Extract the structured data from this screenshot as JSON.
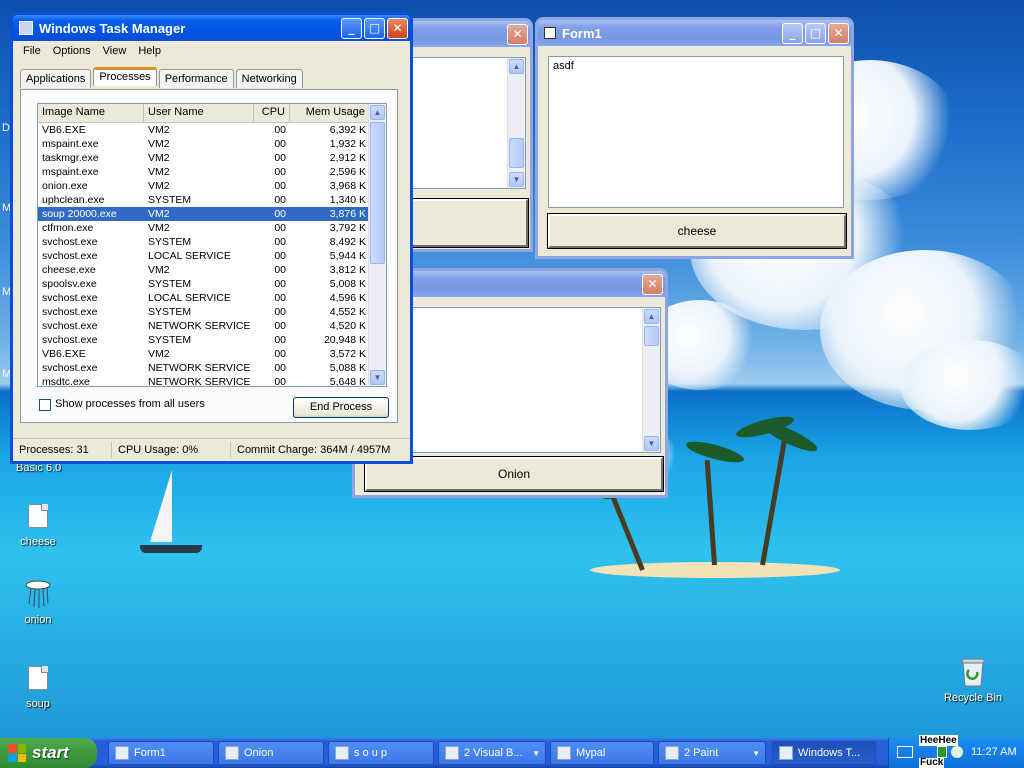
{
  "colors": {
    "xp_blue": "#0054e3",
    "selection": "#316ac5",
    "start_green": "#3c9a3c",
    "tray_blue": "#0f6fd8"
  },
  "desktop": {
    "partial_label": "Basic 6.0",
    "left_edge_letters": [
      "D",
      "M",
      "M",
      "M"
    ],
    "icons": [
      {
        "label": "cheese",
        "icon": "folder-icon"
      },
      {
        "label": "onion",
        "icon": "onion-icon"
      },
      {
        "label": "soup",
        "icon": "file-icon"
      },
      {
        "label": "Recycle Bin",
        "icon": "recycle-bin-icon"
      }
    ]
  },
  "task_manager": {
    "title": "Windows Task Manager",
    "menu": [
      "File",
      "Options",
      "View",
      "Help"
    ],
    "tabs": [
      "Applications",
      "Processes",
      "Performance",
      "Networking"
    ],
    "active_tab": "Processes",
    "columns": [
      "Image Name",
      "User Name",
      "CPU",
      "Mem Usage"
    ],
    "rows": [
      [
        "VB6.EXE",
        "VM2",
        "00",
        "6,392 K"
      ],
      [
        "mspaint.exe",
        "VM2",
        "00",
        "1,932 K"
      ],
      [
        "taskmgr.exe",
        "VM2",
        "00",
        "2,912 K"
      ],
      [
        "mspaint.exe",
        "VM2",
        "00",
        "2,596 K"
      ],
      [
        "onion.exe",
        "VM2",
        "00",
        "3,968 K"
      ],
      [
        "uphclean.exe",
        "SYSTEM",
        "00",
        "1,340 K"
      ],
      [
        "soup 20000.exe",
        "VM2",
        "00",
        "3,876 K"
      ],
      [
        "ctfmon.exe",
        "VM2",
        "00",
        "3,792 K"
      ],
      [
        "svchost.exe",
        "SYSTEM",
        "00",
        "8,492 K"
      ],
      [
        "svchost.exe",
        "LOCAL SERVICE",
        "00",
        "5,944 K"
      ],
      [
        "cheese.exe",
        "VM2",
        "00",
        "3,812 K"
      ],
      [
        "spoolsv.exe",
        "SYSTEM",
        "00",
        "5,008 K"
      ],
      [
        "svchost.exe",
        "LOCAL SERVICE",
        "00",
        "4,596 K"
      ],
      [
        "svchost.exe",
        "SYSTEM",
        "00",
        "4,552 K"
      ],
      [
        "svchost.exe",
        "NETWORK SERVICE",
        "00",
        "4,520 K"
      ],
      [
        "svchost.exe",
        "SYSTEM",
        "00",
        "20,948 K"
      ],
      [
        "VB6.EXE",
        "VM2",
        "00",
        "3,572 K"
      ],
      [
        "svchost.exe",
        "NETWORK SERVICE",
        "00",
        "5,088 K"
      ],
      [
        "msdtc.exe",
        "NETWORK SERVICE",
        "00",
        "5,648 K"
      ]
    ],
    "selected_row": "soup 20000.exe",
    "show_all_label": "Show processes from all users",
    "end_process_label": "End Process",
    "status": {
      "processes": "Processes: 31",
      "cpu": "CPU Usage: 0%",
      "commit": "Commit Charge: 364M / 4957M"
    }
  },
  "form1": {
    "title": "Form1",
    "text": "asdf",
    "button": "cheese"
  },
  "onion_form": {
    "button": "Onion"
  },
  "taskbar": {
    "start": "start",
    "buttons": [
      {
        "label": "Form1"
      },
      {
        "label": "Onion"
      },
      {
        "label": "s o u p"
      },
      {
        "label": "2 Visual B..."
      },
      {
        "label": "Mypal"
      },
      {
        "label": "2 Paint"
      },
      {
        "label": "Windows T..."
      }
    ],
    "tray_text": "HeeHee",
    "tray_text2": "Fuck",
    "clock": "11:27 AM"
  }
}
